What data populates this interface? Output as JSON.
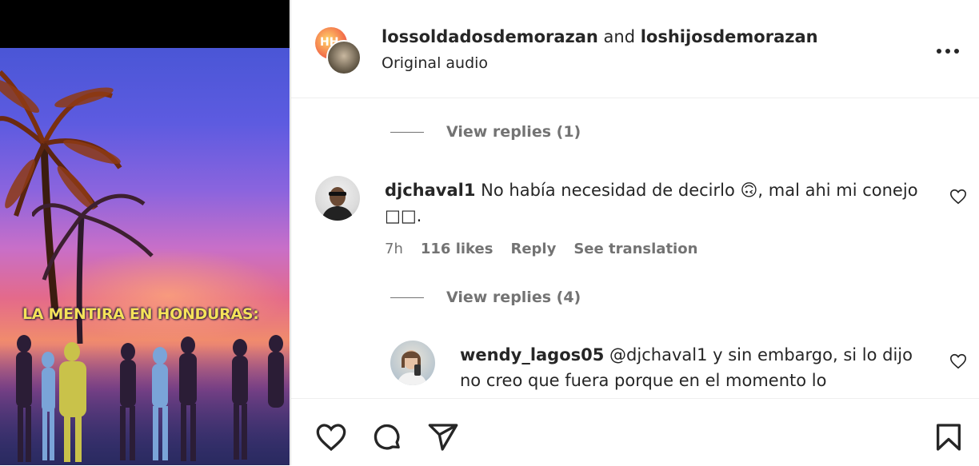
{
  "video": {
    "caption": "LA MENTIRA EN HONDURAS:"
  },
  "header": {
    "user1": "lossoldadosdemorazan",
    "joiner": " and ",
    "user2": "loshijosdemorazan",
    "subtitle": "Original audio",
    "avatar1_text": "HH",
    "more_icon": "more-horizontal-icon"
  },
  "comments": {
    "replies_top": "View replies (1)",
    "c1": {
      "username": "djchaval1",
      "text": " No había necesidad de decirlo 🙃, mal ahi mi conejo",
      "text2": "□□.",
      "time": "7h",
      "likes": "116 likes",
      "reply": "Reply",
      "translate": "See translation"
    },
    "replies_c1": "View replies (4)",
    "c2": {
      "username": "wendy_lagos05",
      "text": " @djchaval1 y sin embargo, si lo dijo",
      "text2": "no creo que fuera porque en el momento lo"
    }
  },
  "actions": {
    "like": "heart-icon",
    "comment": "comment-icon",
    "share": "send-icon",
    "save": "bookmark-icon"
  },
  "colors": {
    "text": "#262626",
    "secondary": "#737373",
    "caption": "#f5e25a"
  }
}
